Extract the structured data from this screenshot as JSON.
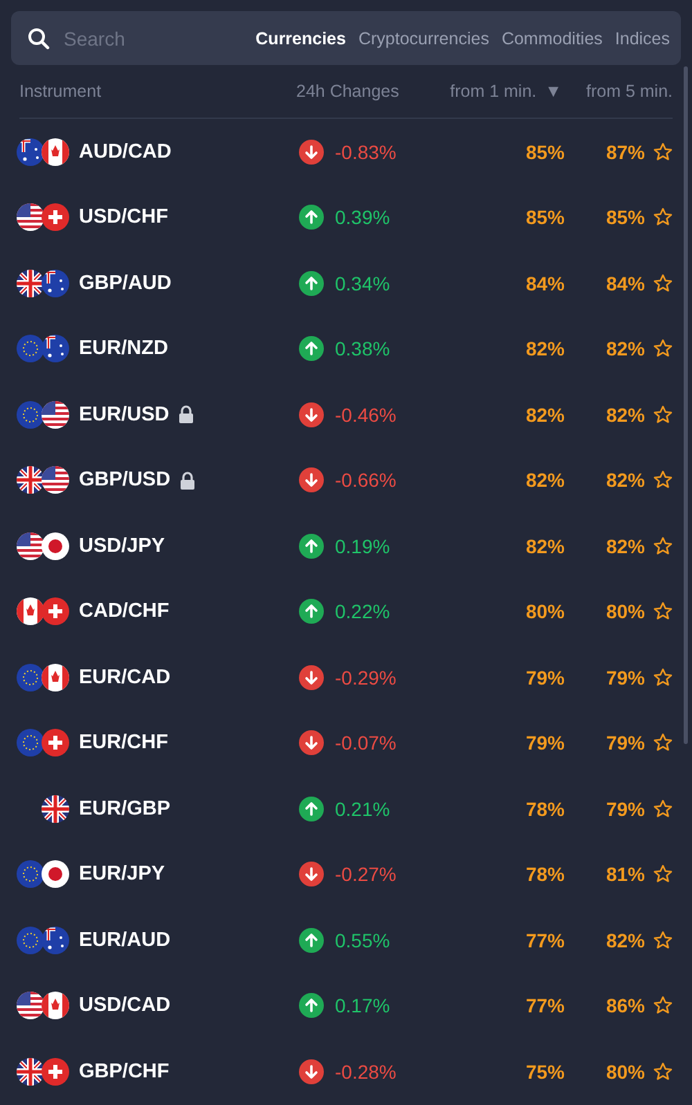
{
  "search": {
    "placeholder": "Search"
  },
  "tabs": [
    {
      "label": "Currencies",
      "selected": true
    },
    {
      "label": "Cryptocurrencies",
      "selected": false
    },
    {
      "label": "Commodities",
      "selected": false
    },
    {
      "label": "Indices",
      "selected": false
    }
  ],
  "columns": [
    "Instrument",
    "24h Changes",
    "from 1 min.",
    "from 5 min."
  ],
  "sort_indicator": "▼",
  "rows": [
    {
      "flags": [
        {
          "kind": "au"
        },
        {
          "kind": "ca"
        }
      ],
      "name": "AUD/CAD",
      "locked": false,
      "rising": false,
      "change": "-0.83%",
      "from_1_min": "85%",
      "from_5_min": "87%",
      "favorite": false
    },
    {
      "flags": [
        {
          "kind": "us"
        },
        {
          "kind": "ch"
        }
      ],
      "name": "USD/CHF",
      "locked": false,
      "rising": true,
      "change": "0.39%",
      "from_1_min": "85%",
      "from_5_min": "85%",
      "favorite": false
    },
    {
      "flags": [
        {
          "kind": "gb"
        },
        {
          "kind": "au"
        }
      ],
      "name": "GBP/AUD",
      "locked": false,
      "rising": true,
      "change": "0.34%",
      "from_1_min": "84%",
      "from_5_min": "84%",
      "favorite": false
    },
    {
      "flags": [
        {
          "kind": "eu"
        },
        {
          "kind": "au"
        }
      ],
      "name": "EUR/NZD",
      "locked": false,
      "rising": true,
      "change": "0.38%",
      "from_1_min": "82%",
      "from_5_min": "82%",
      "favorite": false
    },
    {
      "flags": [
        {
          "kind": "eu"
        },
        {
          "kind": "us"
        }
      ],
      "name": "EUR/USD",
      "locked": true,
      "rising": false,
      "change": "-0.46%",
      "from_1_min": "82%",
      "from_5_min": "82%",
      "favorite": false
    },
    {
      "flags": [
        {
          "kind": "gb"
        },
        {
          "kind": "us"
        }
      ],
      "name": "GBP/USD",
      "locked": true,
      "rising": false,
      "change": "-0.66%",
      "from_1_min": "82%",
      "from_5_min": "82%",
      "favorite": false
    },
    {
      "flags": [
        {
          "kind": "us"
        },
        {
          "kind": "jp"
        }
      ],
      "name": "USD/JPY",
      "locked": false,
      "rising": true,
      "change": "0.19%",
      "from_1_min": "82%",
      "from_5_min": "82%",
      "favorite": false
    },
    {
      "flags": [
        {
          "kind": "ca"
        },
        {
          "kind": "ch"
        }
      ],
      "name": "CAD/CHF",
      "locked": false,
      "rising": true,
      "change": "0.22%",
      "from_1_min": "80%",
      "from_5_min": "80%",
      "favorite": false
    },
    {
      "flags": [
        {
          "kind": "eu"
        },
        {
          "kind": "ca"
        }
      ],
      "name": "EUR/CAD",
      "locked": false,
      "rising": false,
      "change": "-0.29%",
      "from_1_min": "79%",
      "from_5_min": "79%",
      "favorite": false
    },
    {
      "flags": [
        {
          "kind": "eu"
        },
        {
          "kind": "ch"
        }
      ],
      "name": "EUR/CHF",
      "locked": false,
      "rising": false,
      "change": "-0.07%",
      "from_1_min": "79%",
      "from_5_min": "79%",
      "favorite": false
    },
    {
      "flags": [
        {
          "kind": "gb"
        }
      ],
      "name": "EUR/GBP",
      "locked": false,
      "rising": true,
      "change": "0.21%",
      "from_1_min": "78%",
      "from_5_min": "79%",
      "favorite": false
    },
    {
      "flags": [
        {
          "kind": "eu"
        },
        {
          "kind": "jp"
        }
      ],
      "name": "EUR/JPY",
      "locked": false,
      "rising": false,
      "change": "-0.27%",
      "from_1_min": "78%",
      "from_5_min": "81%",
      "favorite": false
    },
    {
      "flags": [
        {
          "kind": "eu"
        },
        {
          "kind": "au"
        }
      ],
      "name": "EUR/AUD",
      "locked": false,
      "rising": true,
      "change": "0.55%",
      "from_1_min": "77%",
      "from_5_min": "82%",
      "favorite": false
    },
    {
      "flags": [
        {
          "kind": "us"
        },
        {
          "kind": "ca"
        }
      ],
      "name": "USD/CAD",
      "locked": false,
      "rising": true,
      "change": "0.17%",
      "from_1_min": "77%",
      "from_5_min": "86%",
      "favorite": false
    },
    {
      "flags": [
        {
          "kind": "gb"
        },
        {
          "kind": "ch"
        }
      ],
      "name": "GBP/CHF",
      "locked": false,
      "rising": false,
      "change": "-0.28%",
      "from_1_min": "75%",
      "from_5_min": "80%",
      "favorite": false
    }
  ]
}
